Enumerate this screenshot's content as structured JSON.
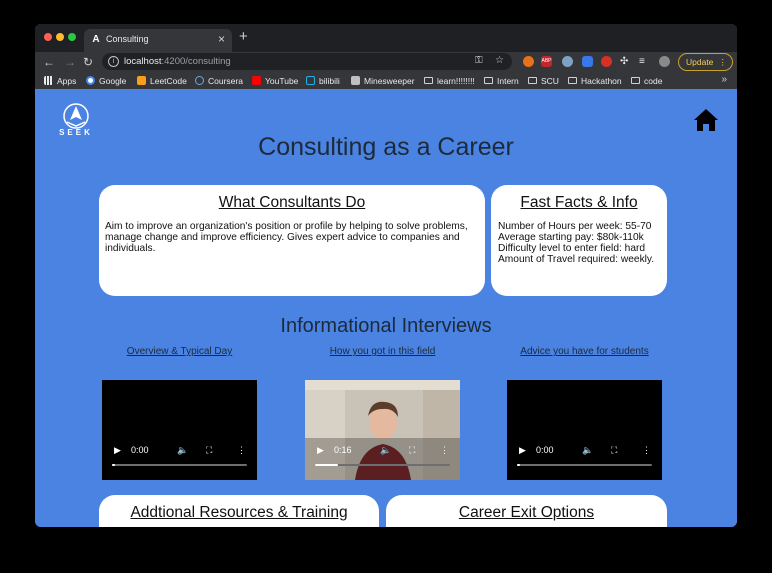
{
  "browser": {
    "tab": {
      "title": "Consulting",
      "favicon": "A"
    },
    "address": {
      "host": "localhost",
      "path": ":4200/consulting"
    },
    "update_label": "Update",
    "bookmarks": [
      {
        "label": "Apps",
        "icon": "apps-grid-icon"
      },
      {
        "label": "Google",
        "icon": "google-icon"
      },
      {
        "label": "LeetCode",
        "icon": "leetcode-icon"
      },
      {
        "label": "Coursera",
        "icon": "coursera-icon"
      },
      {
        "label": "YouTube",
        "icon": "youtube-icon"
      },
      {
        "label": "bilibili",
        "icon": "bilibili-icon"
      },
      {
        "label": "Minesweeper",
        "icon": "minesweeper-icon"
      },
      {
        "label": "learn!!!!!!!!",
        "icon": "folder-icon"
      },
      {
        "label": "Intern",
        "icon": "folder-icon"
      },
      {
        "label": "SCU",
        "icon": "folder-icon"
      },
      {
        "label": "Hackathon",
        "icon": "folder-icon"
      },
      {
        "label": "code",
        "icon": "folder-icon"
      }
    ],
    "more_bookmarks": "»"
  },
  "page": {
    "logo_text": "SEEK",
    "title": "Consulting as a Career",
    "what_card": {
      "title": "What Consultants Do",
      "body": "Aim to improve an organization's position or profile by helping to solve problems, manage change and improve efficiency. Gives expert advice to companies and individuals."
    },
    "facts_card": {
      "title": "Fast Facts & Info",
      "lines": [
        "Number of Hours per week: 55-70",
        "Average starting pay: $80k-110k",
        "Difficulty level to enter field: hard",
        "Amount of Travel required: weekly."
      ]
    },
    "interviews": {
      "title": "Informational Interviews",
      "videos": [
        {
          "label": "Overview & Typical Day",
          "time": "0:00",
          "progress": 0.02
        },
        {
          "label": "How you got in this field",
          "time": "0:16",
          "progress": 0.17
        },
        {
          "label": "Advice you have for students",
          "time": "0:00",
          "progress": 0.02
        }
      ]
    },
    "resources_card": {
      "title": "Addtional Resources & Training"
    },
    "exit_card": {
      "title": "Career Exit Options"
    }
  },
  "colors": {
    "page_bg": "#4a83e2",
    "chrome": "#35363a",
    "update": "#f6cf57"
  }
}
